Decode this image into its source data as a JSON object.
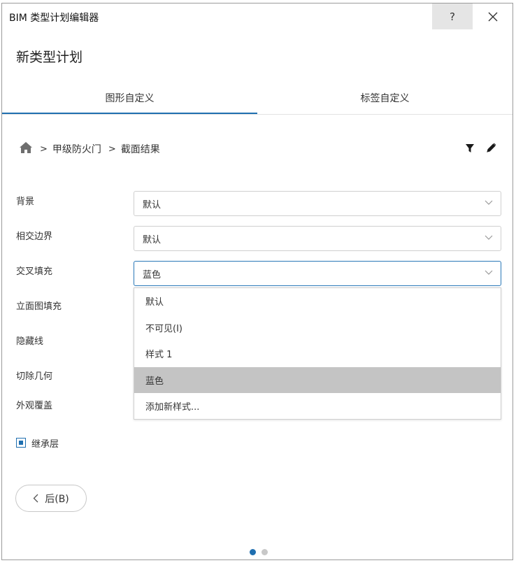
{
  "window": {
    "title": "BIM 类型计划编辑器",
    "help_label": "?"
  },
  "page": {
    "heading": "新类型计划"
  },
  "tabs": [
    {
      "label": "图形自定义",
      "active": true
    },
    {
      "label": "标签自定义",
      "active": false
    }
  ],
  "breadcrumb": {
    "items": [
      "甲级防火门",
      "截面结果"
    ],
    "separator": ">"
  },
  "fields": {
    "background": {
      "label": "背景",
      "value": "默认"
    },
    "intersect_border": {
      "label": "相交边界",
      "value": "默认"
    },
    "cross_fill": {
      "label": "交叉填充",
      "value": "蓝色"
    },
    "elevation_fill": {
      "label": "立面图填充"
    },
    "hidden_line": {
      "label": "隐藏线"
    },
    "cut_geometry": {
      "label": "切除几何"
    },
    "appearance_override": {
      "label": "外观覆盖"
    }
  },
  "dropdown": {
    "options": [
      "默认",
      "不可见(I)",
      "样式 1",
      "蓝色",
      "添加新样式..."
    ],
    "selected": "蓝色"
  },
  "inherit_layer": {
    "label": "继承层",
    "checked": true
  },
  "back_button": {
    "label": "后(B)"
  },
  "pagination": {
    "current": 1,
    "total": 2
  },
  "colors": {
    "accent": "#1f6fb0",
    "hover": "#c4c4c4",
    "dot_inactive": "#c8c8c8"
  }
}
